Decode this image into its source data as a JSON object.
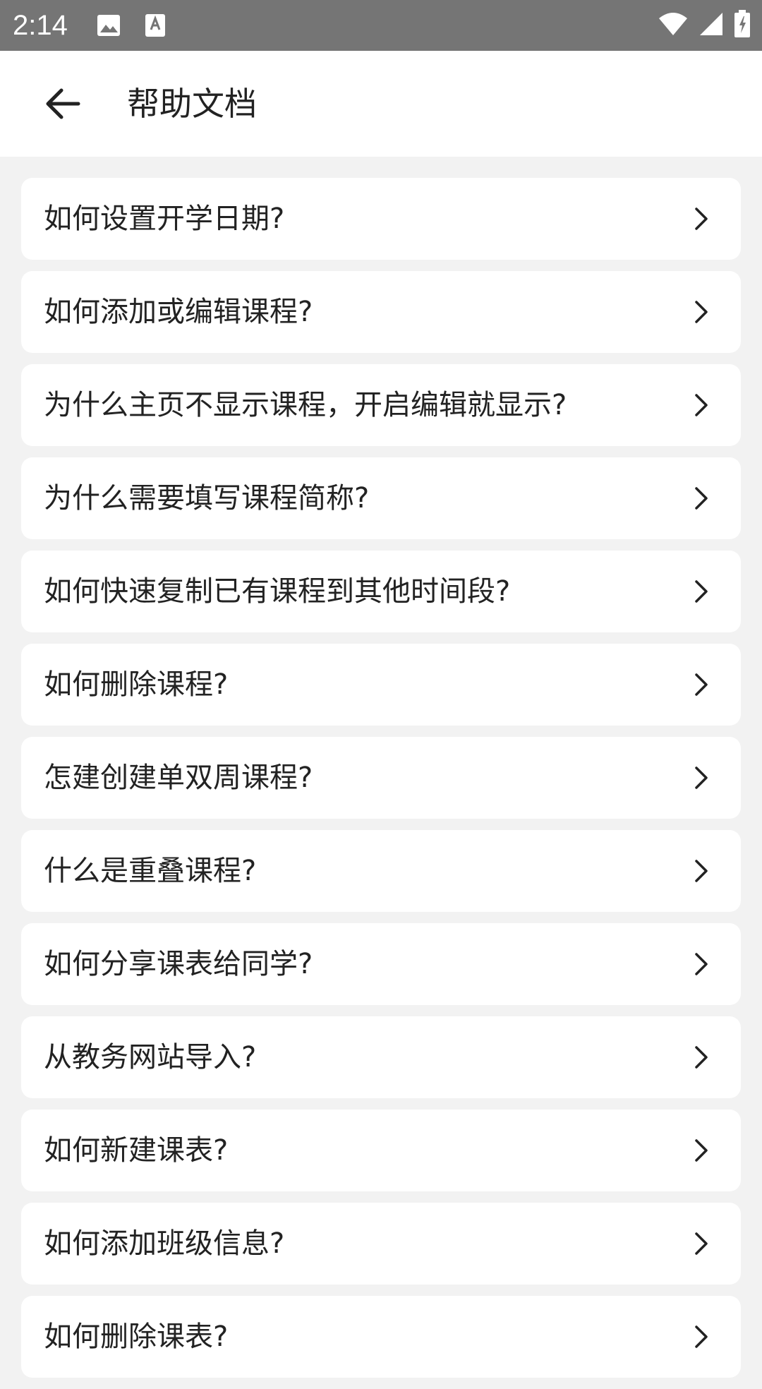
{
  "status_bar": {
    "time": "2:14",
    "icons": [
      "image-icon",
      "text-icon",
      "wifi-icon",
      "signal-icon",
      "battery-icon"
    ]
  },
  "app_bar": {
    "title": "帮助文档",
    "back_icon": "arrow-left-icon"
  },
  "help_items": [
    {
      "label": "如何设置开学日期?"
    },
    {
      "label": "如何添加或编辑课程?"
    },
    {
      "label": "为什么主页不显示课程，开启编辑就显示?"
    },
    {
      "label": "为什么需要填写课程简称?"
    },
    {
      "label": "如何快速复制已有课程到其他时间段?"
    },
    {
      "label": "如何删除课程?"
    },
    {
      "label": "怎建创建单双周课程?"
    },
    {
      "label": "什么是重叠课程?"
    },
    {
      "label": "如何分享课表给同学?"
    },
    {
      "label": "从教务网站导入?"
    },
    {
      "label": "如何新建课表?"
    },
    {
      "label": "如何添加班级信息?"
    },
    {
      "label": "如何删除课表?"
    }
  ],
  "colors": {
    "status_bar": "#757575",
    "background": "#f2f2f2",
    "card": "#ffffff",
    "text": "#222222"
  }
}
